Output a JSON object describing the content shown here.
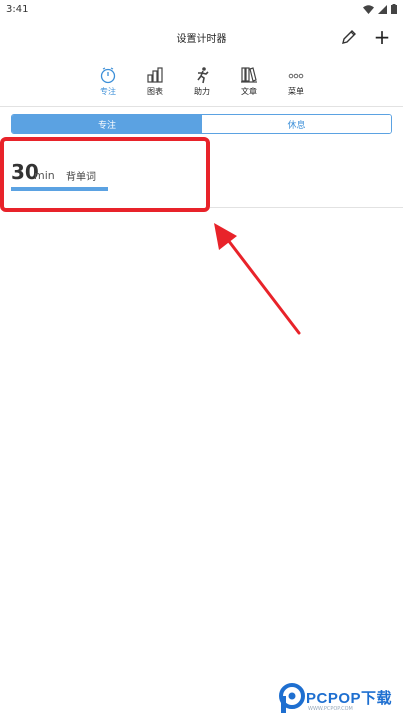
{
  "status_bar": {
    "time": "3:41"
  },
  "header": {
    "title": "设置计时器",
    "edit_icon": "pencil-icon",
    "add_label": "+"
  },
  "nav": {
    "items": [
      {
        "label": "专注",
        "icon": "stopwatch-icon",
        "active": true
      },
      {
        "label": "图表",
        "icon": "bar-chart-icon",
        "active": false
      },
      {
        "label": "助力",
        "icon": "runner-icon",
        "active": false
      },
      {
        "label": "文章",
        "icon": "bookshelf-icon",
        "active": false
      },
      {
        "label": "菜单",
        "icon": "more-dots-icon",
        "active": false
      }
    ]
  },
  "segmented": {
    "focus_label": "专注",
    "rest_label": "休息",
    "selected": "专注"
  },
  "timer_card": {
    "value": "30",
    "unit": "min",
    "task": "背单词",
    "progress": 1.0
  },
  "annotation": {
    "highlight_color": "#e8232a",
    "arrow_color": "#e8232a"
  },
  "colors": {
    "accent": "#5ba2e2",
    "accent_text": "#3c8fd8"
  },
  "watermark": {
    "text": "PCPOP下载",
    "sub": "WWW.PCPOP.COM"
  }
}
